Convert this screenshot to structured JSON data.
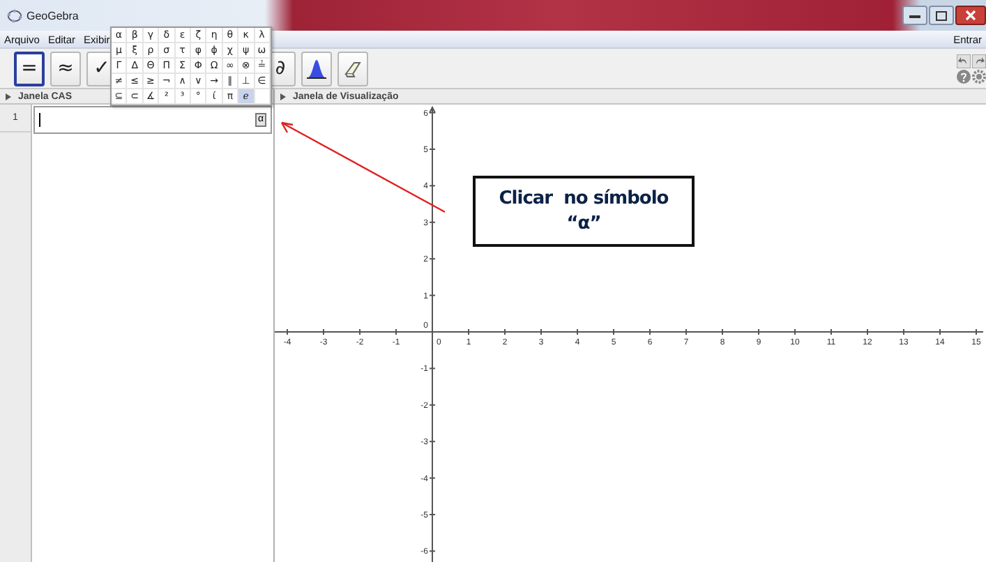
{
  "window": {
    "title": "GeoGebra"
  },
  "menu": [
    "Arquivo",
    "Editar",
    "Exibir"
  ],
  "login": "Entrar",
  "toolbar": [
    {
      "kind": "text",
      "label": "=",
      "selected": true
    },
    {
      "kind": "text",
      "label": "≈",
      "selected": false
    },
    {
      "kind": "text",
      "label": "✓",
      "selected": false
    },
    {
      "kind": "text",
      "label": "∂",
      "selected": false
    },
    {
      "kind": "distribution",
      "selected": false
    },
    {
      "kind": "eraser",
      "selected": false
    }
  ],
  "symbol_popup": {
    "rows": [
      [
        {
          "symbol": "α",
          "selected": false
        },
        {
          "symbol": "β",
          "selected": false
        },
        {
          "symbol": "γ",
          "selected": false
        },
        {
          "symbol": "δ",
          "selected": false
        },
        {
          "symbol": "ε",
          "selected": false
        },
        {
          "symbol": "ζ",
          "selected": false
        },
        {
          "symbol": "η",
          "selected": false
        },
        {
          "symbol": "θ",
          "selected": false
        },
        {
          "symbol": "κ",
          "selected": false
        },
        {
          "symbol": "λ",
          "selected": false
        }
      ],
      [
        {
          "symbol": "μ",
          "selected": false
        },
        {
          "symbol": "ξ",
          "selected": false
        },
        {
          "symbol": "ρ",
          "selected": false
        },
        {
          "symbol": "σ",
          "selected": false
        },
        {
          "symbol": "τ",
          "selected": false
        },
        {
          "symbol": "φ",
          "selected": false
        },
        {
          "symbol": "ϕ",
          "selected": false
        },
        {
          "symbol": "χ",
          "selected": false
        },
        {
          "symbol": "ψ",
          "selected": false
        },
        {
          "symbol": "ω",
          "selected": false
        }
      ],
      [
        {
          "symbol": "Γ",
          "selected": false
        },
        {
          "symbol": "Δ",
          "selected": false
        },
        {
          "symbol": "Θ",
          "selected": false
        },
        {
          "symbol": "Π",
          "selected": false
        },
        {
          "symbol": "Σ",
          "selected": false
        },
        {
          "symbol": "Φ",
          "selected": false
        },
        {
          "symbol": "Ω",
          "selected": false
        },
        {
          "symbol": "∞",
          "selected": false
        },
        {
          "symbol": "⊗",
          "selected": false
        },
        {
          "symbol": "≟",
          "selected": false
        }
      ],
      [
        {
          "symbol": "≠",
          "selected": false
        },
        {
          "symbol": "≤",
          "selected": false
        },
        {
          "symbol": "≥",
          "selected": false
        },
        {
          "symbol": "¬",
          "selected": false
        },
        {
          "symbol": "∧",
          "selected": false
        },
        {
          "symbol": "∨",
          "selected": false
        },
        {
          "symbol": "→",
          "selected": false
        },
        {
          "symbol": "∥",
          "selected": false
        },
        {
          "symbol": "⊥",
          "selected": false
        },
        {
          "symbol": "∈",
          "selected": false
        }
      ],
      [
        {
          "symbol": "⊆",
          "selected": false
        },
        {
          "symbol": "⊂",
          "selected": false
        },
        {
          "symbol": "∡",
          "selected": false
        },
        {
          "symbol": "²",
          "selected": false
        },
        {
          "symbol": "³",
          "selected": false
        },
        {
          "symbol": "°",
          "selected": false
        },
        {
          "symbol": "ί",
          "selected": false
        },
        {
          "symbol": "π",
          "selected": false
        },
        {
          "symbol": "ℯ",
          "selected": true
        }
      ]
    ]
  },
  "cas": {
    "title": "Janela CAS",
    "rows": [
      {
        "number": "1",
        "symbol_button": "α"
      }
    ]
  },
  "graphics": {
    "title": "Janela de Visualização",
    "x_labels": [
      "-4",
      "-3",
      "-2",
      "-1",
      "0",
      "1",
      "2",
      "3",
      "4",
      "5",
      "6",
      "7",
      "8",
      "9",
      "10",
      "11",
      "12",
      "13",
      "14",
      "15"
    ],
    "y_labels": [
      "6",
      "5",
      "4",
      "3",
      "2",
      "1",
      "0",
      "-1",
      "-2",
      "-3",
      "-4",
      "-5",
      "-6"
    ]
  },
  "callout": {
    "text": "Clicar  no símbolo\n“α”"
  }
}
